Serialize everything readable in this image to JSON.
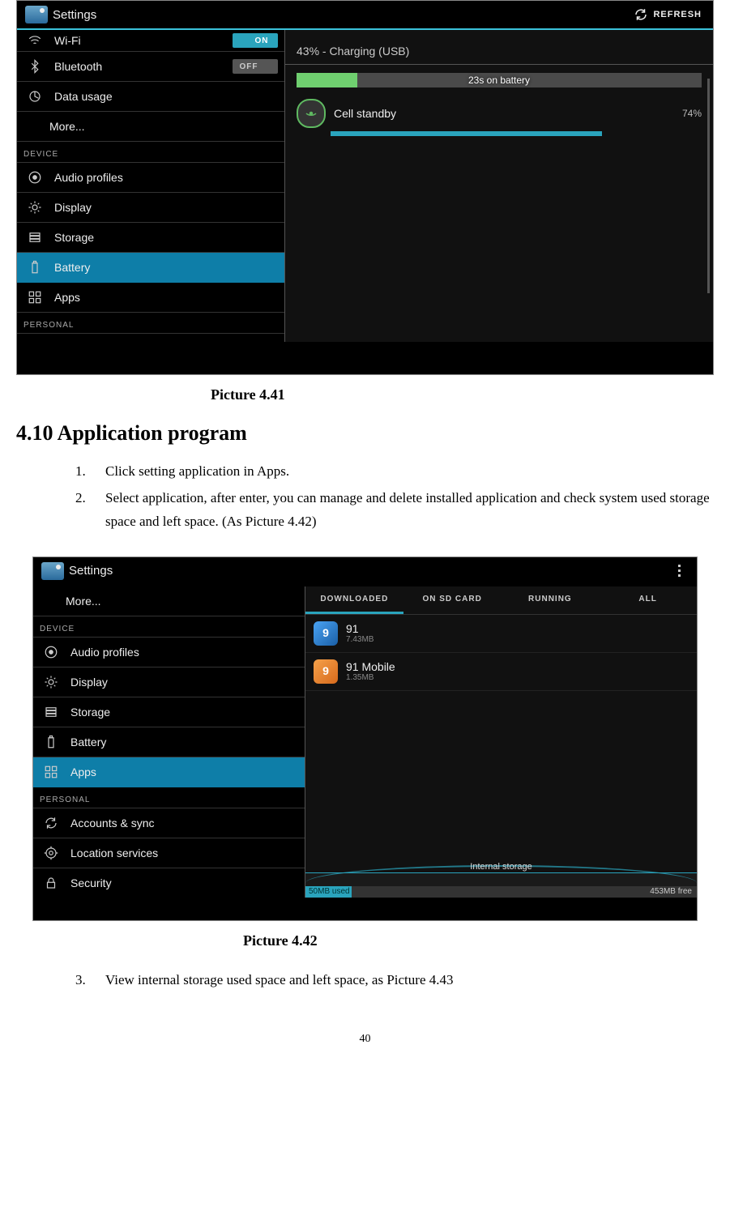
{
  "caption41": "Picture 4.41",
  "caption42": "Picture 4.42",
  "heading": "4.10   Application program",
  "steps": [
    "Click setting application in Apps.",
    "Select application, after enter, you can manage and delete installed application and check system used storage space and left space. (As Picture 4.42)",
    "View internal storage used space and left space, as Picture 4.43"
  ],
  "pageNo": "40",
  "pic41": {
    "title": "Settings",
    "refresh": "REFRESH",
    "wifi": {
      "label": "Wi-Fi",
      "state": "ON"
    },
    "bluetooth": {
      "label": "Bluetooth",
      "state": "OFF"
    },
    "dataUsage": "Data usage",
    "more": "More...",
    "deviceHdr": "DEVICE",
    "audioProfiles": "Audio profiles",
    "display": "Display",
    "storage": "Storage",
    "battery": "Battery",
    "apps": "Apps",
    "personalHdr": "PERSONAL",
    "batStatus": "43% - Charging (USB)",
    "batTime": "23s on battery",
    "cellStandby": "Cell standby",
    "cellStandbyPct": "74%"
  },
  "pic42": {
    "title": "Settings",
    "more": "More...",
    "deviceHdr": "DEVICE",
    "audioProfiles": "Audio profiles",
    "display": "Display",
    "storage": "Storage",
    "battery": "Battery",
    "apps": "Apps",
    "personalHdr": "PERSONAL",
    "accounts": "Accounts & sync",
    "location": "Location services",
    "security": "Security",
    "tabs": [
      "DOWNLOADED",
      "ON SD CARD",
      "RUNNING",
      "ALL"
    ],
    "appsList": [
      {
        "name": "91",
        "size": "7.43MB"
      },
      {
        "name": "91 Mobile",
        "size": "1.35MB"
      }
    ],
    "storageLabel": "Internal storage",
    "used": "50MB used",
    "free": "453MB free"
  }
}
